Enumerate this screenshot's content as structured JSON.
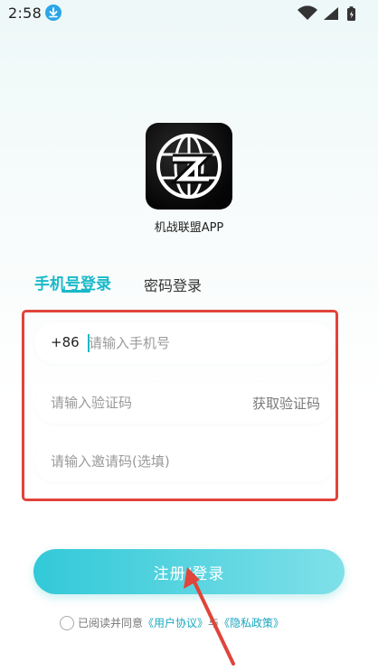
{
  "status_bar": {
    "time": "2:58",
    "icons": [
      "download-icon",
      "wifi-icon",
      "cellular-icon",
      "battery-icon"
    ]
  },
  "app": {
    "name": "机战联盟APP",
    "logo_icon": "globe-zl-logo"
  },
  "tabs": [
    {
      "label": "手机号登录",
      "active": true
    },
    {
      "label": "密码登录",
      "active": false
    }
  ],
  "form": {
    "phone": {
      "country_code": "+86",
      "placeholder": "请输入手机号",
      "value": ""
    },
    "code": {
      "placeholder": "请输入验证码",
      "value": "",
      "action_label": "获取验证码"
    },
    "invite": {
      "placeholder": "请输入邀请码(选填)",
      "value": ""
    }
  },
  "submit_label": "注册/登录",
  "agreement": {
    "prefix": "已阅读并同意",
    "user_agreement": "《用户协议》",
    "conjunction": "与",
    "privacy_policy": "《隐私政策》"
  },
  "colors": {
    "accent": "#19b9c8",
    "annotation": "#e0443a",
    "link": "#19a7c0"
  }
}
